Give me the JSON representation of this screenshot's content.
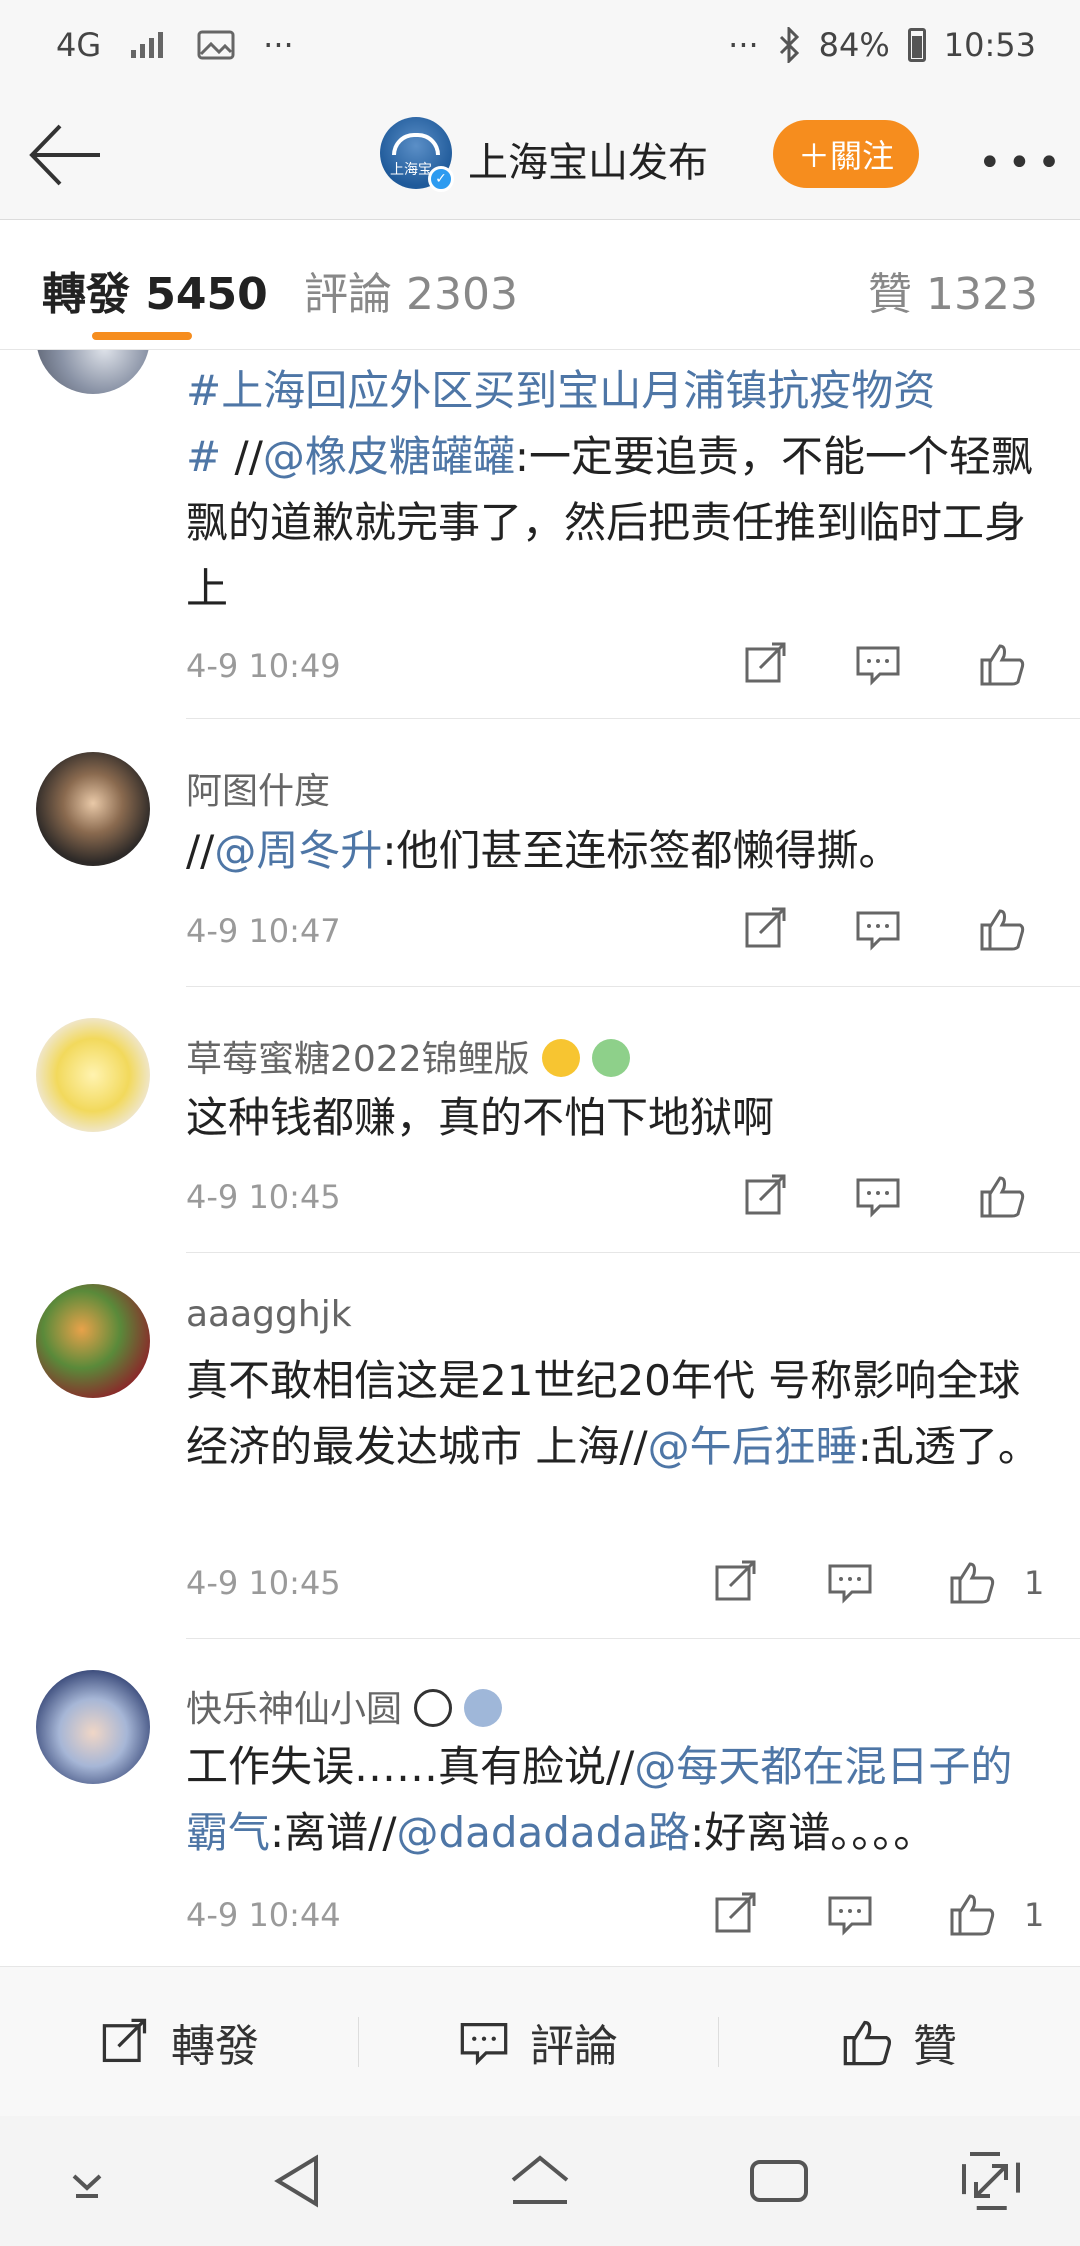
{
  "status_bar": {
    "network": "4G",
    "dots_left": "···",
    "dots_right": "···",
    "battery": "84%",
    "time": "10:53"
  },
  "header": {
    "avatar_label": "上海宝",
    "title": "上海宝山发布",
    "follow_label": "＋關注"
  },
  "tabs": {
    "repost": "轉發 5450",
    "comments": "評論 2303",
    "likes": "贊 1323"
  },
  "comments": [
    {
      "user": "",
      "segments": [
        {
          "t": "#上海回应外区买到宝山月浦镇抗疫物资",
          "link": true
        },
        {
          "t": "\n",
          "link": false
        },
        {
          "t": "# ",
          "link": true
        },
        {
          "t": "//",
          "link": false
        },
        {
          "t": "@橡皮糖罐罐",
          "link": true
        },
        {
          "t": ":一定要追责，不能一个轻飘飘的道歉就完事了，然后把责任推到临时工身上",
          "link": false
        }
      ],
      "time": "4-9 10:49",
      "likes": ""
    },
    {
      "user": "阿图什度",
      "segments": [
        {
          "t": "//",
          "link": false
        },
        {
          "t": "@周冬升",
          "link": true
        },
        {
          "t": ":他们甚至连标签都懒得撕。",
          "link": false
        }
      ],
      "time": "4-9 10:47",
      "likes": ""
    },
    {
      "user": "草莓蜜糖2022锦鲤版",
      "segments": [
        {
          "t": "这种钱都赚，真的不怕下地狱啊",
          "link": false
        }
      ],
      "time": "4-9 10:45",
      "likes": ""
    },
    {
      "user": "aaagghjk",
      "segments": [
        {
          "t": "真不敢相信这是21世纪20年代 号称影响全球经济的最发达城市 上海",
          "link": false
        },
        {
          "t": "//",
          "link": false
        },
        {
          "t": "@午后狂睡",
          "link": true
        },
        {
          "t": ":乱透了。",
          "link": false
        }
      ],
      "time": "4-9 10:45",
      "likes": "1"
    },
    {
      "user": "快乐神仙小圆",
      "segments": [
        {
          "t": "工作失误……真有脸说//",
          "link": false
        },
        {
          "t": "@每天都在混日子的霸气",
          "link": true
        },
        {
          "t": ":离谱//",
          "link": false
        },
        {
          "t": "@dadadada路",
          "link": true
        },
        {
          "t": ":好离谱。。。。",
          "link": false
        }
      ],
      "time": "4-9 10:44",
      "likes": "1"
    }
  ],
  "bottom_bar": {
    "repost": "轉發",
    "comment": "評論",
    "like": "贊"
  },
  "colors": {
    "accent": "#f68d1e",
    "link": "#4e76a6",
    "verified": "#2d9bf0"
  },
  "icons": [
    "back-arrow-icon",
    "more-icon",
    "repost-icon",
    "comment-icon",
    "like-icon",
    "nav-down-icon",
    "nav-back-icon",
    "nav-home-icon",
    "nav-recents-icon",
    "nav-expand-icon"
  ]
}
